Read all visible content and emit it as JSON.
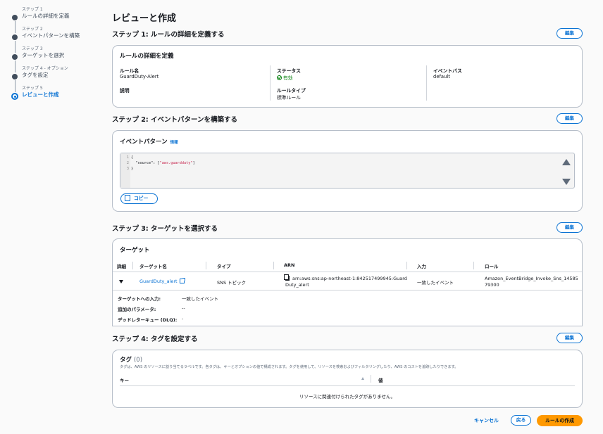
{
  "stepper": [
    {
      "label": "ステップ 1",
      "title": "ルールの詳細を定義"
    },
    {
      "label": "ステップ 2",
      "title": "イベントパターンを構築"
    },
    {
      "label": "ステップ 3",
      "title": "ターゲットを選択"
    },
    {
      "label": "ステップ 4 - オプション",
      "title": "タグを設定"
    },
    {
      "label": "ステップ 5",
      "title": "レビューと作成"
    }
  ],
  "page_title": "レビューと作成",
  "edit_label": "編集",
  "step1": {
    "header": "ステップ 1: ルールの詳細を定義する",
    "card_title": "ルールの詳細を定義",
    "rule_name_label": "ルール名",
    "rule_name": "GuardDuty-Alert",
    "description_label": "説明",
    "status_label": "ステータス",
    "status": "有効",
    "rule_type_label": "ルールタイプ",
    "rule_type": "標準ルール",
    "event_bus_label": "イベントバス",
    "event_bus": "default"
  },
  "step2": {
    "header": "ステップ 2: イベントパターンを構築する",
    "card_title": "イベントパターン",
    "info": "情報",
    "code": [
      {
        "n": "1",
        "text": "{"
      },
      {
        "n": "2",
        "key": "  \"source\": [",
        "str": "\"aws.guardduty\"",
        "end": "]"
      },
      {
        "n": "3",
        "text": "}"
      }
    ],
    "copy_label": "コピー"
  },
  "step3": {
    "header": "ステップ 3: ターゲットを選択する",
    "card_title": "ターゲット",
    "columns": [
      "詳細",
      "ターゲット名",
      "タイプ",
      "ARN",
      "入力",
      "ロール"
    ],
    "row": {
      "name": "GuardDuty_alert",
      "type": "SNS トピック",
      "arn_line1": "arn:aws:sns:ap-northeast-1:842517499945:Guard",
      "arn_line2": "Duty_alert",
      "input": "一致したイベント",
      "role_line1": "Amazon_EventBridge_Invoke_Sns_14585",
      "role_line2": "79300"
    },
    "details": [
      {
        "label": "ターゲットへの入力:",
        "value": "一致したイベント"
      },
      {
        "label": "追加のパラメータ:",
        "value": "--"
      },
      {
        "label": "デッドレターキュー (DLQ):",
        "value": "-"
      }
    ]
  },
  "step4": {
    "header": "ステップ 4: タグを設定する",
    "card_title": "タグ",
    "count": "(0)",
    "description": "タグは、AWS のリソースに割り当てるラベルです。各タグは、キーとオプションの値で構成されます。タグを使用して、リソースを検索およびフィルタリングしたり、AWS のコストを追跡したりできます。",
    "key_col": "キー",
    "value_col": "値",
    "empty": "リソースに関連付けられたタグがありません。"
  },
  "footer": {
    "cancel": "キャンセル",
    "back": "戻る",
    "create": "ルールの作成"
  }
}
